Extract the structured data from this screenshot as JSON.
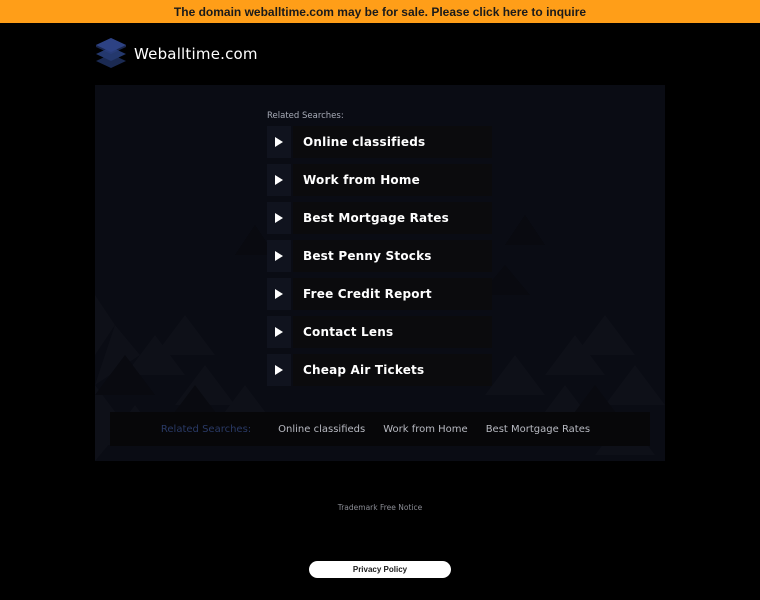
{
  "banner": {
    "text": "The domain weballtime.com may be for sale. Please click here to inquire",
    "bg_color": "#ff9e18"
  },
  "logo": {
    "icon": "stacked-layers-icon",
    "text": "Weballtime.com"
  },
  "related_label": "Related Searches:",
  "results": [
    {
      "label": "Online classifieds",
      "icon": "play-arrow-icon"
    },
    {
      "label": "Work from Home",
      "icon": "play-arrow-icon"
    },
    {
      "label": "Best Mortgage Rates",
      "icon": "play-arrow-icon"
    },
    {
      "label": "Best Penny Stocks",
      "icon": "play-arrow-icon"
    },
    {
      "label": "Free Credit Report",
      "icon": "play-arrow-icon"
    },
    {
      "label": "Contact Lens",
      "icon": "play-arrow-icon"
    },
    {
      "label": "Cheap Air Tickets",
      "icon": "play-arrow-icon"
    }
  ],
  "bottom_bar": {
    "label": "Related Searches:",
    "links": [
      "Online classifieds",
      "Work from Home",
      "Best Mortgage Rates"
    ]
  },
  "footer": {
    "trademark": "Trademark Free Notice",
    "privacy": "Privacy Policy"
  },
  "colors": {
    "background": "#000000",
    "panel": "#0a0c14",
    "accent": "#2a3a66"
  }
}
